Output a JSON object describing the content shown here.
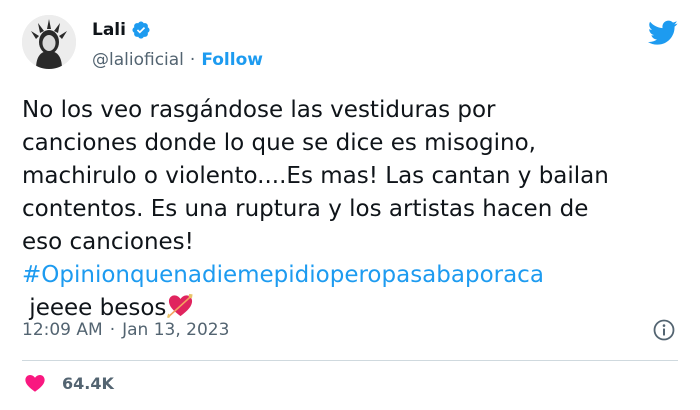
{
  "author": {
    "name": "Lali",
    "handle": "@lalioficial",
    "separator": "·",
    "follow_label": "Follow"
  },
  "tweet": {
    "lines": [
      "No los veo rasgándose las vestiduras por",
      "canciones donde lo que se dice es misogino,",
      "machirulo o violento....Es mas! Las cantan y bailan",
      "contentos. Es una ruptura y los artistas hacen de",
      "eso canciones!"
    ],
    "hashtag": "#Opinionquenadiemepidioperopasabaporaca",
    "closing": " jeeee besos",
    "emoji_icon": "heart-with-arrow-icon"
  },
  "meta": {
    "time": "12:09 AM",
    "separator": "·",
    "date": "Jan 13, 2023"
  },
  "engagement": {
    "likes": "64.4K"
  },
  "colors": {
    "accent": "#1d9bf0",
    "text": "#0f1419",
    "secondary": "#536471",
    "heart": "#f91880"
  }
}
